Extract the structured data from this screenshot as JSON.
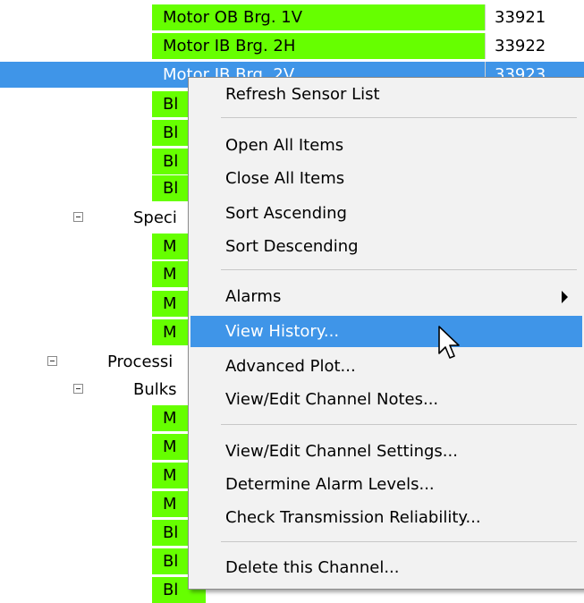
{
  "tree": {
    "rows": [
      {
        "name": "Motor OB Brg. 1V",
        "id": "33921"
      },
      {
        "name": "Motor IB Brg. 2H",
        "id": "33922"
      },
      {
        "name": "Motor IB Brg. 2V",
        "id": "33923"
      },
      {
        "name": "Bl",
        "id": ""
      },
      {
        "name": "Bl",
        "id": ""
      },
      {
        "name": "Bl",
        "id": ""
      },
      {
        "name": "Bl",
        "id": ""
      },
      {
        "name": "Speci",
        "id": ""
      },
      {
        "name": "M",
        "id": ""
      },
      {
        "name": "M",
        "id": ""
      },
      {
        "name": "M",
        "id": ""
      },
      {
        "name": "M",
        "id": ""
      },
      {
        "name": "Processi",
        "id": ""
      },
      {
        "name": "Bulks",
        "id": ""
      },
      {
        "name": "M",
        "id": ""
      },
      {
        "name": "M",
        "id": ""
      },
      {
        "name": "M",
        "id": ""
      },
      {
        "name": "M",
        "id": ""
      },
      {
        "name": "Bl",
        "id": ""
      },
      {
        "name": "Bl",
        "id": ""
      },
      {
        "name": "Bl",
        "id": ""
      }
    ]
  },
  "context_menu": {
    "items": [
      {
        "label": "Refresh Sensor List"
      },
      {
        "label": "Open All Items"
      },
      {
        "label": "Close All Items"
      },
      {
        "label": "Sort Ascending"
      },
      {
        "label": "Sort Descending"
      },
      {
        "label": "Alarms"
      },
      {
        "label": "View History..."
      },
      {
        "label": "Advanced Plot..."
      },
      {
        "label": "View/Edit Channel Notes..."
      },
      {
        "label": "View/Edit Channel Settings..."
      },
      {
        "label": "Determine Alarm Levels..."
      },
      {
        "label": "Check Transmission Reliability..."
      },
      {
        "label": "Delete this Channel..."
      }
    ],
    "submenu_icon": "chevron-right-icon",
    "cursor_icon": "mouse-pointer-icon"
  },
  "colors": {
    "status_ok": "#66ff00",
    "selection": "#3f95e8",
    "menu_background": "#f2f2f2"
  }
}
